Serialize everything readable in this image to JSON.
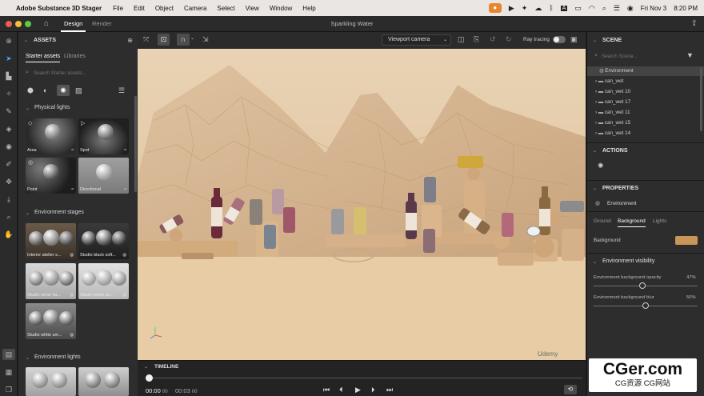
{
  "menubar": {
    "app_name": "Adobe Substance 3D Stager",
    "items": [
      "File",
      "Edit",
      "Object",
      "Camera",
      "Select",
      "View",
      "Window",
      "Help"
    ],
    "date": "Fri Nov 3",
    "time": "8:20 PM"
  },
  "titlebar": {
    "tab_design": "Design",
    "tab_render": "Render",
    "document_title": "Sparkling Water"
  },
  "assets": {
    "header": "ASSETS",
    "tab_starter": "Starter assets",
    "tab_libraries": "Libraries",
    "search_placeholder": "Search Starter assets...",
    "physical_lights_header": "Physical lights",
    "physical_lights": [
      "Area",
      "Spot",
      "Point",
      "Directional"
    ],
    "environment_stages_header": "Environment stages",
    "environment_stages": [
      "Interior atelier s...",
      "Studio black soft...",
      "Studio white ha...",
      "Studio white so...",
      "Studio white um..."
    ],
    "environment_lights_header": "Environment lights"
  },
  "viewport_toolbar": {
    "camera_select": "Viewport camera",
    "ray_tracing_label": "Ray tracing"
  },
  "scene": {
    "header": "SCENE",
    "search_placeholder": "Search Scene...",
    "items": [
      "Environment",
      "can_wet",
      "can_wet 10",
      "can_wet 17",
      "can_wet 11",
      "can_wet 15",
      "can_wet 14"
    ]
  },
  "actions": {
    "header": "ACTIONS"
  },
  "properties": {
    "header": "PROPERTIES",
    "selected": "Environment",
    "tabs": [
      "Ground",
      "Background",
      "Lights"
    ],
    "background_label": "Background",
    "background_color": "#c9965a",
    "visibility_header": "Environment visibility",
    "bg_opacity_label": "Environment background opacity",
    "bg_opacity_value": "47%",
    "bg_opacity_fraction": 0.47,
    "bg_blur_label": "Environment background blur",
    "bg_blur_value": "50%",
    "bg_blur_fraction": 0.5
  },
  "timeline": {
    "header": "TIMELINE",
    "current_time": "00:00",
    "current_frames": "00",
    "end_time": "00:03",
    "end_frames": "00"
  },
  "watermark": {
    "brand": "Udemy",
    "logo_text": "CGer.com",
    "subtitle": "CG资源 CG网站"
  },
  "colors": {
    "accent": "#e8862d",
    "panel": "#2d2d2d",
    "viewport_bg": "#e3c9a6"
  }
}
